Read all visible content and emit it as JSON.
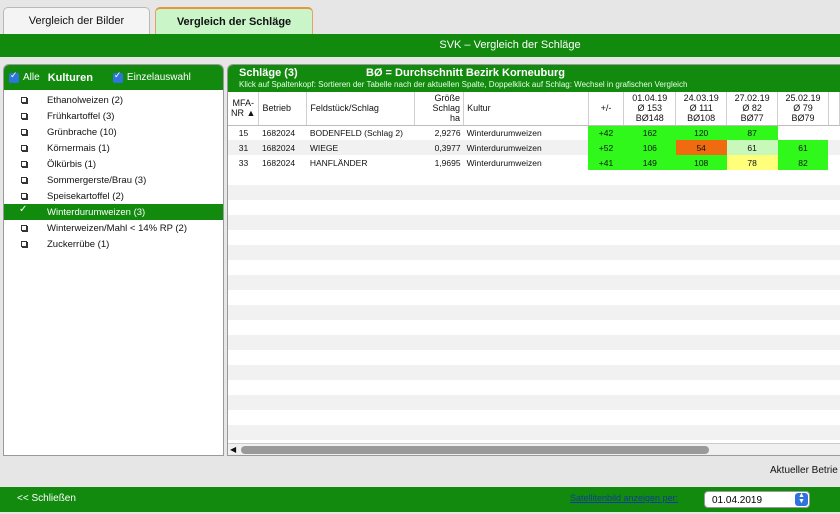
{
  "tabs": [
    {
      "label": "Vergleich der Bilder"
    },
    {
      "label": "Vergleich der Schläge"
    }
  ],
  "window_title": "SVK – Vergleich der Schläge",
  "left": {
    "all_label": "Alle",
    "kulturen_label": "Kulturen",
    "einzel_label": "Einzelauswahl",
    "items": [
      {
        "label": "Ethanolweizen (2)"
      },
      {
        "label": "Frühkartoffel (3)"
      },
      {
        "label": "Grünbrache (10)"
      },
      {
        "label": "Körnermais (1)"
      },
      {
        "label": "Ölkürbis (1)"
      },
      {
        "label": "Sommergerste/Brau (3)"
      },
      {
        "label": "Speisekartoffel (2)"
      },
      {
        "label": "Winterdurumweizen (3)"
      },
      {
        "label": "Winterweizen/Mahl < 14% RP (2)"
      },
      {
        "label": "Zuckerrübe (1)"
      }
    ]
  },
  "right": {
    "title": "Schläge (3)",
    "avg_label": "BØ = Durchschnitt Bezirk Korneuburg",
    "hint": "Klick auf Spaltenkopf: Sortieren der Tabelle nach der aktuellen Spalte, Doppelklick auf Schlag: Wechsel in grafischen Vergleich",
    "headers": {
      "mfa1": "MFA-",
      "mfa2": "NR ▲",
      "betrieb": "Betrieb",
      "feld": "Feldstück/Schlag",
      "g1": "Größe",
      "g2": "Schlag",
      "g3": "ha",
      "kultur": "Kultur",
      "pm": "+/-"
    },
    "date_cols": [
      {
        "date": "01.04.19",
        "avg": "Ø 153",
        "b": "BØ148"
      },
      {
        "date": "24.03.19",
        "avg": "Ø 111",
        "b": "BØ108"
      },
      {
        "date": "27.02.19",
        "avg": "Ø 82",
        "b": "BØ77"
      },
      {
        "date": "25.02.19",
        "avg": "Ø 79",
        "b": "BØ79"
      }
    ],
    "rows": [
      {
        "mfa": "15",
        "betrieb": "1682024",
        "feld": "BODENFELD (Schlag 2)",
        "groesse": "2,9276",
        "kultur": "Winterdurumweizen",
        "pm": "+42",
        "v1": "162",
        "v2": "120",
        "v3": "87",
        "v4": ""
      },
      {
        "mfa": "31",
        "betrieb": "1682024",
        "feld": "WIEGE",
        "groesse": "0,3977",
        "kultur": "Winterdurumweizen",
        "pm": "+52",
        "v1": "106",
        "v2": "54",
        "v3": "61",
        "v4": "61"
      },
      {
        "mfa": "33",
        "betrieb": "1682024",
        "feld": "HANFLÄNDER",
        "groesse": "1,9695",
        "kultur": "Winterdurumweizen",
        "pm": "+41",
        "v1": "149",
        "v2": "108",
        "v3": "78",
        "v4": "82"
      }
    ]
  },
  "status": "Aktueller Betrie",
  "bottom": {
    "close": "<< Schließen",
    "sat_link": "Satellitenbild anzeigen per:",
    "date_select": "01.04.2019"
  },
  "colors": {
    "green": "#118a0e",
    "cell_green": "#2ff81a",
    "cell_orange": "#f06a10",
    "cell_lightgreen": "#c8f9bb",
    "cell_yellow": "#ffff7a"
  }
}
